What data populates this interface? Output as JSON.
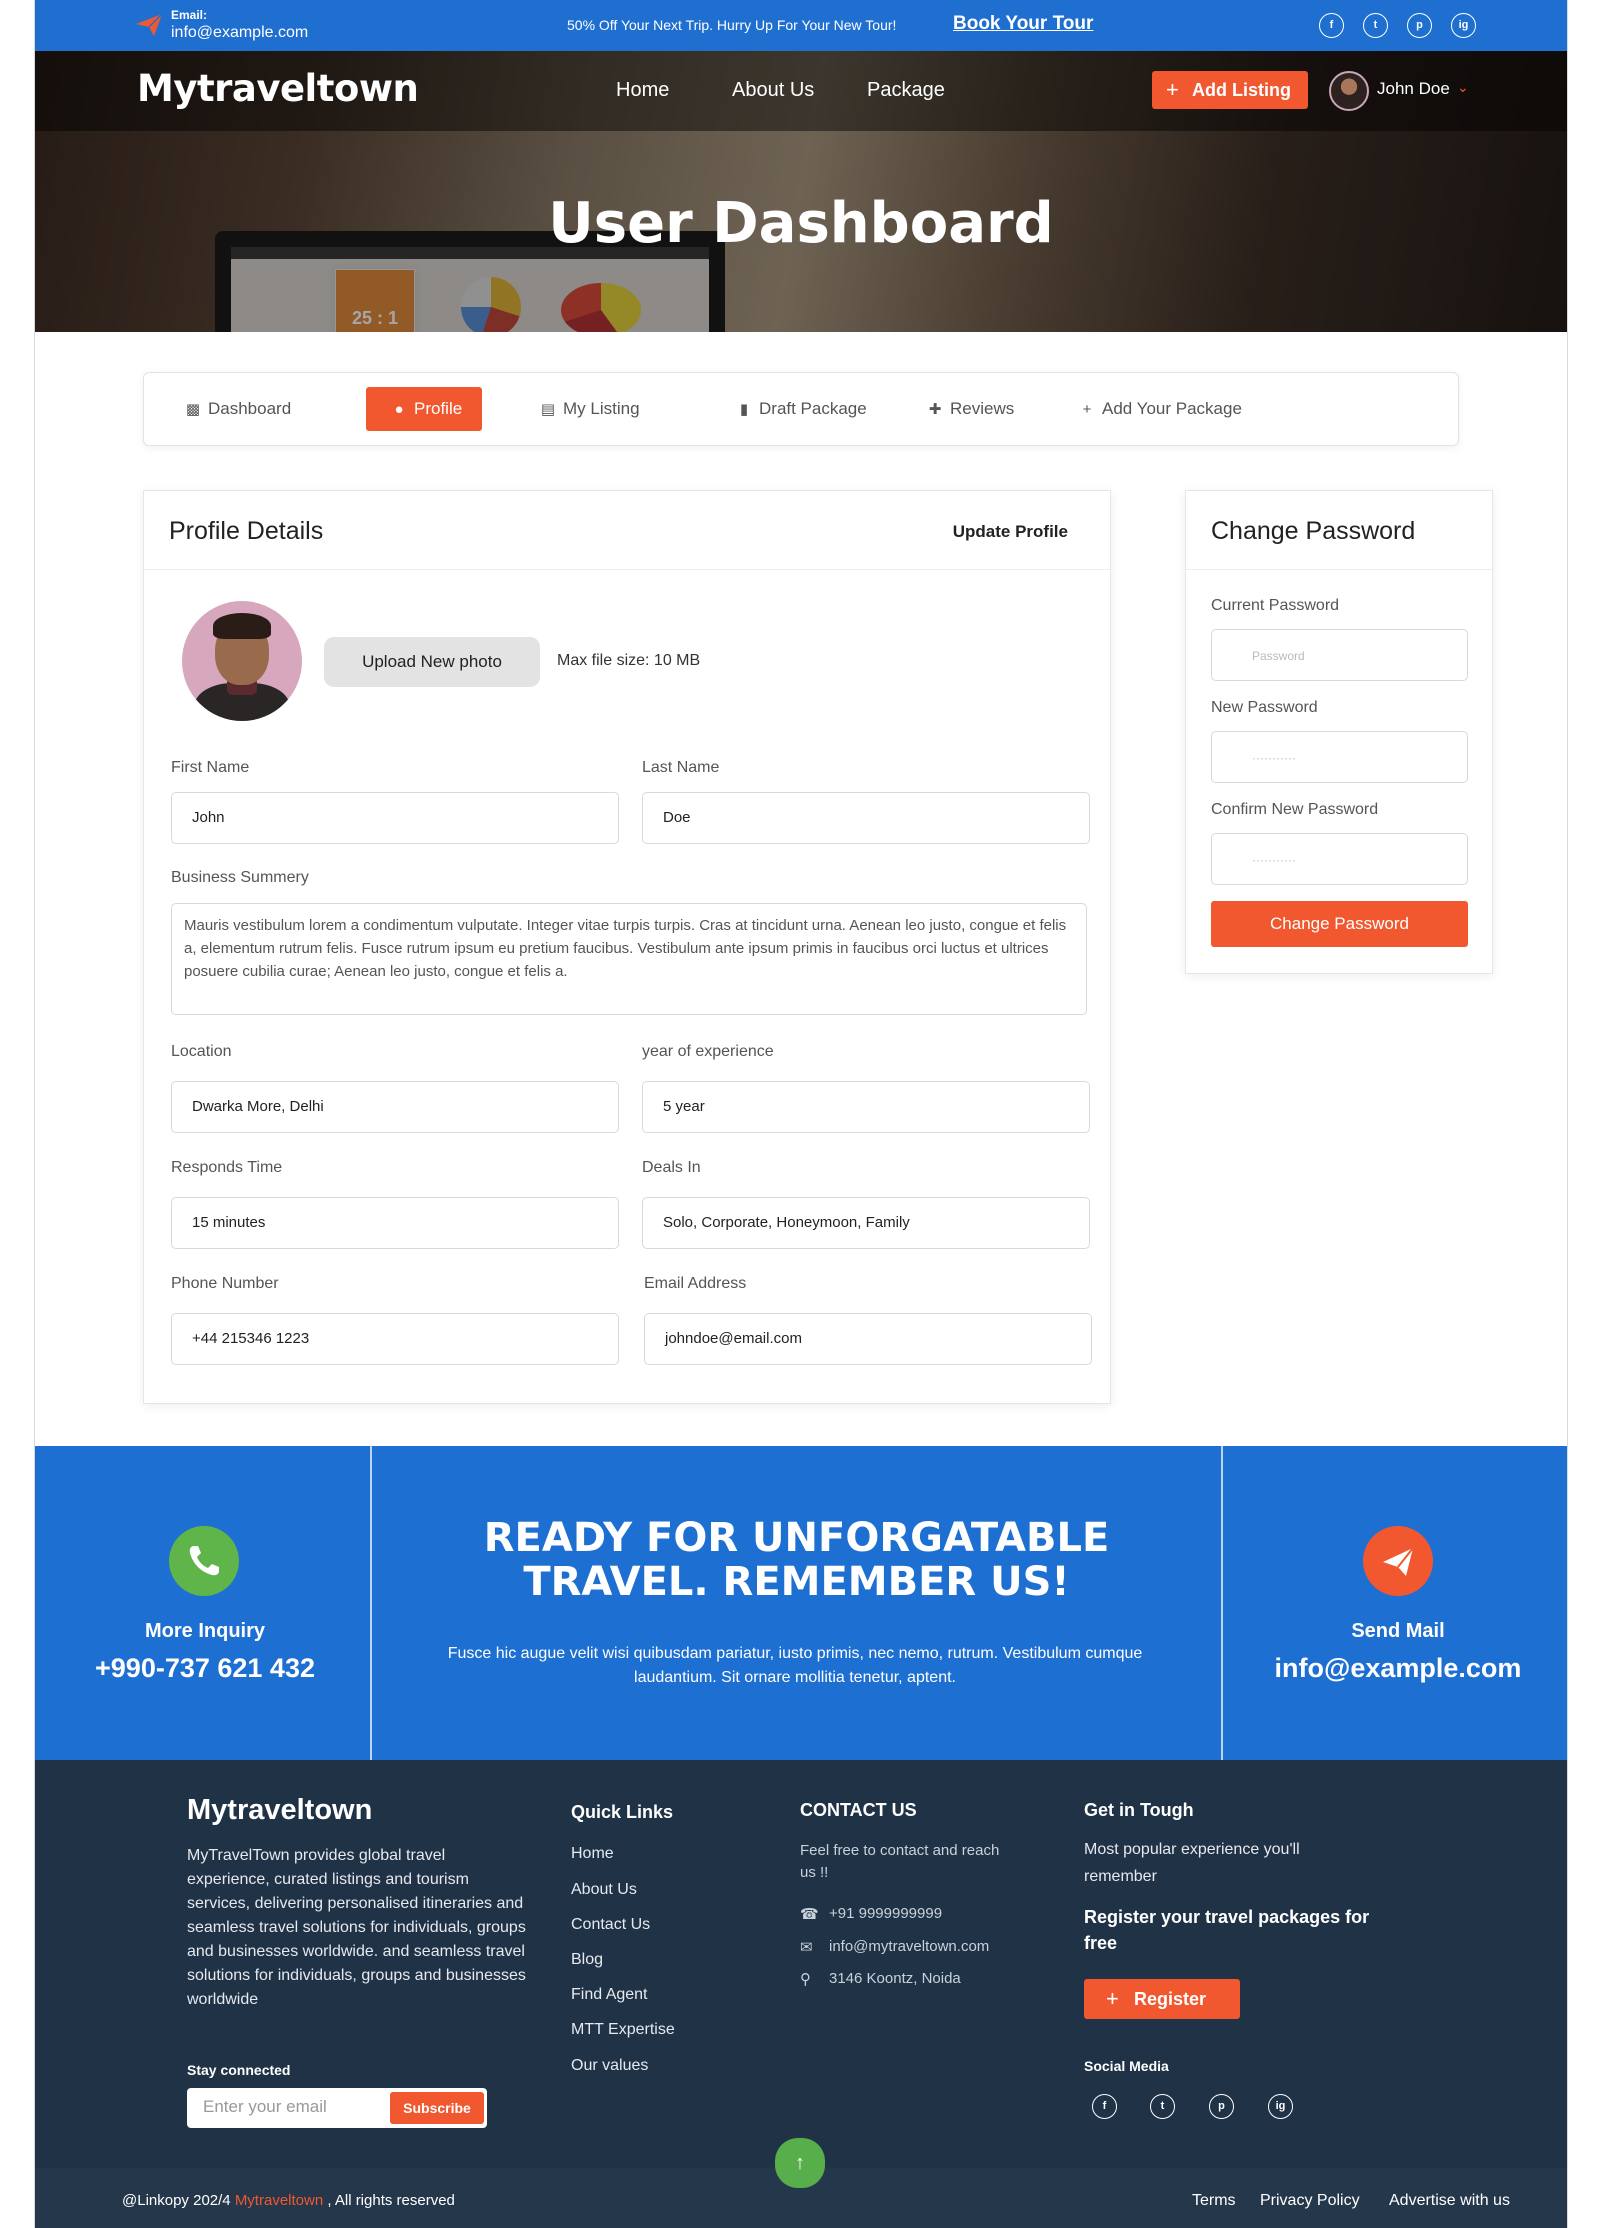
{
  "topbar": {
    "email_label": "Email:",
    "email_value": "info@example.com",
    "promo": "50% Off Your Next Trip. Hurry Up For Your New Tour!",
    "book_link": "Book Your Tour",
    "social": [
      "f",
      "t",
      "p",
      "ig"
    ]
  },
  "header": {
    "logo": "Mytraveltown",
    "nav": [
      "Home",
      "About Us",
      "Package"
    ],
    "add_listing": "Add Listing",
    "user_name": "John Doe"
  },
  "hero": {
    "title": "User Dashboard",
    "screen_text": "25 : 1"
  },
  "tabs": [
    {
      "label": "Dashboard",
      "icon": "dashboard-icon"
    },
    {
      "label": "Profile",
      "icon": "user-icon"
    },
    {
      "label": "My Listing",
      "icon": "list-icon"
    },
    {
      "label": "Draft Package",
      "icon": "file-icon"
    },
    {
      "label": "Reviews",
      "icon": "review-icon"
    },
    {
      "label": "Add Your Package",
      "icon": "plus-icon"
    }
  ],
  "profile": {
    "title": "Profile Details",
    "update": "Update Profile",
    "upload": "Upload New photo",
    "max_size": "Max file size: 10 MB",
    "fields": {
      "first_name": {
        "label": "First Name",
        "value": "John"
      },
      "last_name": {
        "label": "Last Name",
        "value": "Doe"
      },
      "summary": {
        "label": "Business Summery",
        "value": "Mauris vestibulum lorem a condimentum vulputate. Integer vitae turpis turpis. Cras at tincidunt urna. Aenean leo justo, congue et felis a, elementum rutrum felis. Fusce rutrum ipsum eu pretium faucibus. Vestibulum ante ipsum primis in faucibus orci luctus et ultrices posuere cubilia curae; Aenean leo justo, congue et felis a."
      },
      "location": {
        "label": "Location",
        "value": "Dwarka More, Delhi"
      },
      "experience": {
        "label": "year of experience",
        "value": "5 year"
      },
      "responds": {
        "label": "Responds Time",
        "value": "15 minutes"
      },
      "deals": {
        "label": "Deals In",
        "value": "Solo, Corporate, Honeymoon, Family"
      },
      "phone": {
        "label": "Phone Number",
        "value": "+44 215346 1223"
      },
      "email": {
        "label": "Email Address",
        "value": "johndoe@email.com"
      }
    }
  },
  "password": {
    "title": "Change Password",
    "current_label": "Current Password",
    "current_placeholder": "Password",
    "new_label": "New Password",
    "new_placeholder": "···········",
    "confirm_label": "Confirm New Password",
    "confirm_placeholder": "···········",
    "button": "Change Password"
  },
  "cta": {
    "left_label": "More Inquiry",
    "left_value": "+990-737 621 432",
    "headline_1": "READY FOR UNFORGATABLE",
    "headline_2": "TRAVEL. REMEMBER US!",
    "subtext": "Fusce hic augue velit wisi quibusdam pariatur, iusto primis, nec nemo, rutrum. Vestibulum cumque laudantium. Sit ornare mollitia tenetur, aptent.",
    "right_label": "Send Mail",
    "right_value": "info@example.com"
  },
  "footer": {
    "brand": "Mytraveltown",
    "about": "MyTravelTown provides global travel experience, curated listings and tourism services, delivering personalised itineraries and seamless travel solutions for individuals, groups and businesses worldwide.  and seamless travel solutions for individuals, groups and businesses worldwide",
    "stay": "Stay connected",
    "email_placeholder": "Enter your email",
    "subscribe": "Subscribe",
    "quick_title": "Quick Links",
    "quick_links": [
      "Home",
      "About Us",
      "Contact Us",
      "Blog",
      "Find Agent",
      "MTT Expertise",
      "Our values"
    ],
    "contact_title": "CONTACT US",
    "contact_intro": "Feel free to contact and reach us !!",
    "phone": "+91 9999999999",
    "email": "info@mytraveltown.com",
    "address": "3146 Koontz, Noida",
    "touch_title": "Get in Tough",
    "touch_text": "Most popular experience you'll remember",
    "register_text": "Register your travel packages for free",
    "register": "Register",
    "social_title": "Social Media",
    "social": [
      "f",
      "t",
      "p",
      "ig"
    ],
    "copy_prefix": "@Linkopy 202/4",
    "copy_brand": "Mytraveltown",
    "copy_suffix": ", All rights reserved",
    "bottom_links": [
      "Terms",
      "Privacy Policy",
      "Advertise with us"
    ]
  }
}
